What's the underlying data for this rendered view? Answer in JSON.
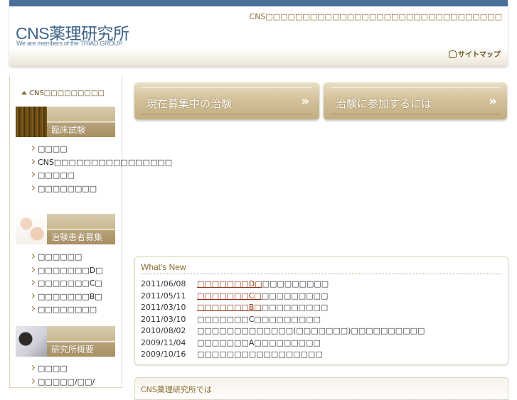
{
  "header": {
    "logo_title": "CNS薬理研究所",
    "logo_sub": "We are members of the TRIAD GROUP.",
    "tagline": "CNS□□□□□□□□□□□□□□□□□□□□□□□□□□□□□□□□",
    "sitemap": "サイトマップ"
  },
  "sidebar": {
    "home": "CNS□□□□□□□□□",
    "sections": [
      {
        "title": "臨床試験",
        "items": [
          "□□□□",
          "CNS□□□□□□□□□□□□□□□□",
          "□□□□□",
          "□□□□□□□□"
        ]
      },
      {
        "title": "治験患者募集",
        "items": [
          "□□□□□□",
          "□□□□□□□D□",
          "□□□□□□□C□",
          "□□□□□□□B□",
          "□□□□□□□□"
        ]
      },
      {
        "title": "研究所概要",
        "items": [
          "□□□□",
          "□□□□□/□□/"
        ]
      }
    ]
  },
  "main": {
    "buttons": [
      {
        "label": "現在募集中の治験",
        "arrow": "»"
      },
      {
        "label": "治験に参加するには",
        "arrow": "»"
      }
    ],
    "news_title": "What's New",
    "news": [
      {
        "date": "2011/06/08",
        "link": "□□□□□□□D□",
        "text": "□□□□□□□□□"
      },
      {
        "date": "2011/05/11",
        "link": "□□□□□□□C□",
        "text": "□□□□□□□□□"
      },
      {
        "date": "2011/03/10",
        "link": "□□□□□□□B□",
        "text": "□□□□□□□□□"
      },
      {
        "date": "2011/03/10",
        "link": "",
        "text": "□□□□□□□C□□□□□□□□□"
      },
      {
        "date": "2010/08/02",
        "link": "",
        "text": "□□□□□□□□□□□□□(□□□□□□□)□□□□□□□□□□"
      },
      {
        "date": "2009/11/04",
        "link": "",
        "text": "□□□□□□□A□□□□□□□□□"
      },
      {
        "date": "2009/10/16",
        "link": "",
        "text": "□□□□□□□□□□□□□□□□□"
      }
    ],
    "intro_title": "CNS薬理研究所では"
  }
}
